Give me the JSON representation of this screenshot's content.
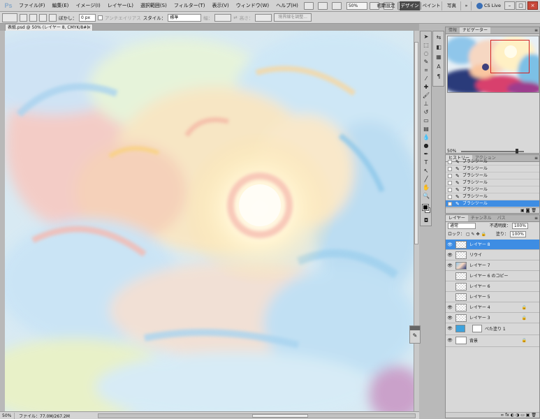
{
  "app": {
    "logo": "Ps"
  },
  "menubar": {
    "items": [
      "ファイル(F)",
      "編集(E)",
      "イメージ(I)",
      "レイヤー(L)",
      "選択範囲(S)",
      "フィルター(T)",
      "表示(V)",
      "ウィンドウ(W)",
      "ヘルプ(H)"
    ],
    "zoom": "50%",
    "workspaces": [
      "初期設定",
      "デザイン",
      "ペイント",
      "写真"
    ],
    "active_workspace": "デザイン",
    "cslive": "CS Live",
    "window_buttons": [
      "–",
      "□",
      "×"
    ]
  },
  "options_bar": {
    "feather_label": "ぼかし：",
    "feather_value": "0 px",
    "antialias_label": "アンチエイリアス",
    "style_label": "スタイル：",
    "style_value": "標準",
    "width_label": "幅：",
    "height_label": "高さ：",
    "refine_button": "境界線を調整..."
  },
  "document": {
    "tab_title": "表紙.psd @ 50% (レイヤー 8, CMYK/8#)",
    "close": "×",
    "status_zoom": "50%",
    "status_doc": "ファイル：77.0M/267.2M"
  },
  "toolbox": {
    "icons": [
      "move-icon",
      "marquee-icon",
      "lasso-icon",
      "quick-select-icon",
      "crop-icon",
      "eyedropper-icon",
      "healing-icon",
      "brush-icon",
      "stamp-icon",
      "history-brush-icon",
      "eraser-icon",
      "gradient-icon",
      "blur-icon",
      "dodge-icon",
      "pen-icon",
      "type-icon",
      "path-select-icon",
      "shape-icon",
      "hand-icon",
      "zoom-icon"
    ]
  },
  "navigator_panel": {
    "tabs": [
      "情報",
      "ナビゲーター"
    ],
    "active_tab": "ナビゲーター",
    "zoom": "50%"
  },
  "history_panel": {
    "tabs": [
      "ヒストリー",
      "アクション"
    ],
    "active_tab": "ヒストリー",
    "items": [
      "ブラシツール",
      "ブラシツール",
      "ブラシツール",
      "ブラシツール",
      "ブラシツール",
      "ブラシツール",
      "ブラシツール"
    ],
    "active_index": 6
  },
  "layers_panel": {
    "tabs": [
      "レイヤー",
      "チャンネル",
      "パス"
    ],
    "active_tab": "レイヤー",
    "blend_mode": "通常",
    "opacity_label": "不透明度：",
    "opacity_value": "100%",
    "lock_label": "ロック：",
    "fill_label": "塗り：",
    "fill_value": "100%",
    "layers": [
      {
        "name": "レイヤー 8",
        "visible": true,
        "locked": false,
        "active": true
      },
      {
        "name": "リウイ",
        "visible": true,
        "locked": false,
        "active": false
      },
      {
        "name": "レイヤー 7",
        "visible": true,
        "locked": false,
        "active": false
      },
      {
        "name": "レイヤー 6 のコピー",
        "visible": false,
        "locked": false,
        "active": false
      },
      {
        "name": "レイヤー 6",
        "visible": false,
        "locked": false,
        "active": false
      },
      {
        "name": "レイヤー 5",
        "visible": false,
        "locked": false,
        "active": false
      },
      {
        "name": "レイヤー 4",
        "visible": true,
        "locked": true,
        "active": false
      },
      {
        "name": "レイヤー 3",
        "visible": true,
        "locked": true,
        "active": false
      },
      {
        "name": "べた塗り 1",
        "visible": true,
        "locked": false,
        "active": false
      },
      {
        "name": "背景",
        "visible": true,
        "locked": true,
        "active": false
      }
    ]
  },
  "colors": {
    "active_blue": "#3e8de3",
    "fill_layer": "#3ea2dc",
    "close_red": "#c8493a"
  }
}
